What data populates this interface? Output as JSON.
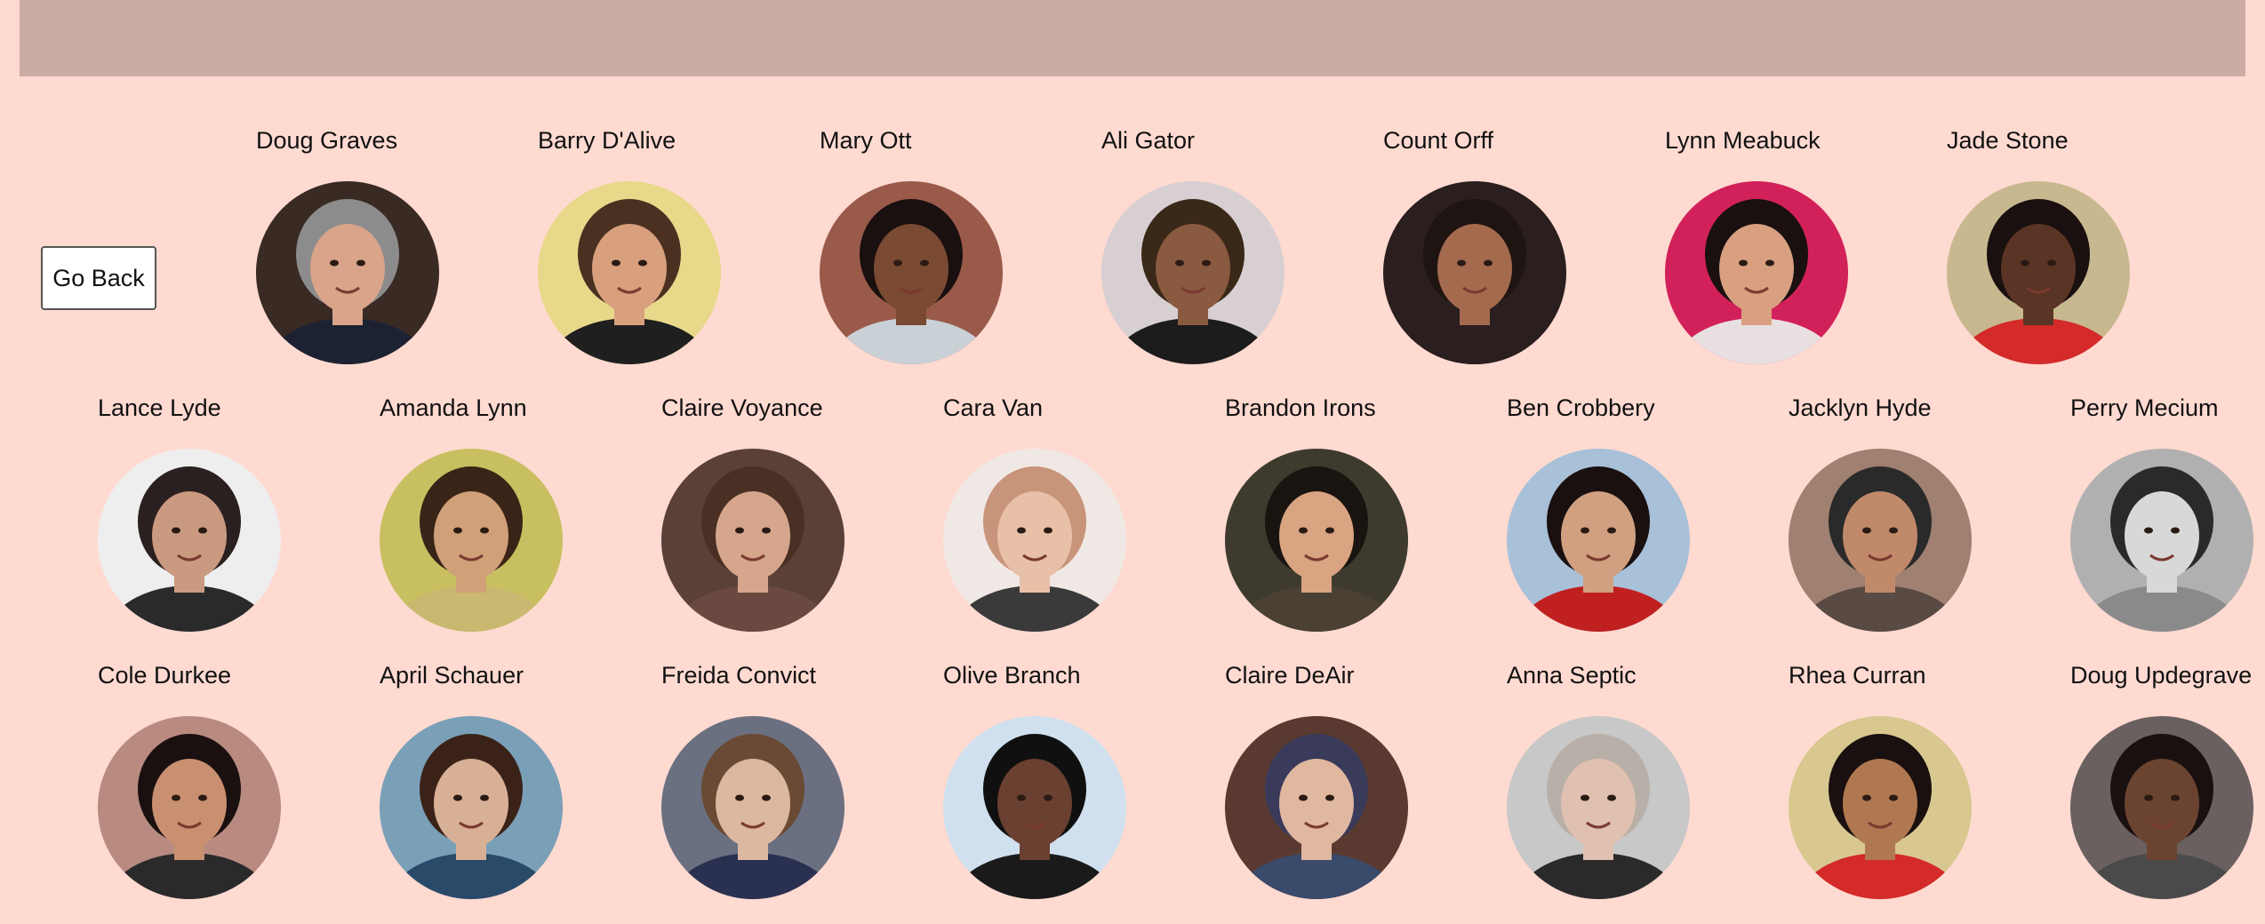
{
  "header": {
    "background_color": "#CBACA5"
  },
  "actions": {
    "go_back_label": "Go Back"
  },
  "page": {
    "background_color": "#FFDAD1"
  },
  "people": [
    {
      "name": "Doug Graves",
      "bg": "#3a2a24",
      "skin": "#d9a48a",
      "hair": "#8c8c8c",
      "shirt": "#1d2233"
    },
    {
      "name": "Barry D'Alive",
      "bg": "#e8d88a",
      "skin": "#d9a07e",
      "hair": "#4a3020",
      "shirt": "#1f1f1f"
    },
    {
      "name": "Mary Ott",
      "bg": "#9a5a4a",
      "skin": "#7a4a32",
      "hair": "#1a1010",
      "shirt": "#c9d0d6"
    },
    {
      "name": "Ali Gator",
      "bg": "#d8cfd2",
      "skin": "#8a5a40",
      "hair": "#3a2818",
      "shirt": "#1c1c1c"
    },
    {
      "name": "Count Orff",
      "bg": "#2a1e1e",
      "skin": "#a46a4e",
      "hair": "#1e1412",
      "shirt": "#2a1e1e"
    },
    {
      "name": "Lynn Meabuck",
      "bg": "#d2215a",
      "skin": "#d8a080",
      "hair": "#1a1010",
      "shirt": "#e8e0e0"
    },
    {
      "name": "Jade Stone",
      "bg": "#c8b890",
      "skin": "#5a3424",
      "hair": "#1a1010",
      "shirt": "#d42a2a"
    },
    {
      "name": "Lance Lyde",
      "bg": "#eeeeee",
      "skin": "#c99a80",
      "hair": "#2a2020",
      "shirt": "#2a2a2a"
    },
    {
      "name": "Amanda Lynn",
      "bg": "#c8c060",
      "skin": "#d0a078",
      "hair": "#3a2418",
      "shirt": "#c8b870"
    },
    {
      "name": "Claire Voyance",
      "bg": "#5a4038",
      "skin": "#d6a68c",
      "hair": "#4a3024",
      "shirt": "#6a4a40"
    },
    {
      "name": "Cara Van",
      "bg": "#f0e8e4",
      "skin": "#e8c0a8",
      "hair": "#c8947a",
      "shirt": "#3a3a3a"
    },
    {
      "name": "Brandon Irons",
      "bg": "#3e3a2e",
      "skin": "#d8a482",
      "hair": "#1a1410",
      "shirt": "#4a4034"
    },
    {
      "name": "Ben Crobbery",
      "bg": "#a8c0d8",
      "skin": "#d0a080",
      "hair": "#1a1010",
      "shirt": "#c02020"
    },
    {
      "name": "Jacklyn Hyde",
      "bg": "#a08070",
      "skin": "#c08a6a",
      "hair": "#2a2a2a",
      "shirt": "#5a4a44"
    },
    {
      "name": "Perry Mecium",
      "bg": "#b0b0b0",
      "skin": "#d8d8d8",
      "hair": "#2a2a2a",
      "shirt": "#8a8a8a"
    },
    {
      "name": "Cole Durkee",
      "bg": "#b88a80",
      "skin": "#c89070",
      "hair": "#1a1010",
      "shirt": "#2a2a2a"
    },
    {
      "name": "April Schauer",
      "bg": "#7aa0b8",
      "skin": "#d8b096",
      "hair": "#3a2218",
      "shirt": "#2a4a6a"
    },
    {
      "name": "Freida Convict",
      "bg": "#6a7080",
      "skin": "#dcb8a0",
      "hair": "#6a4a34",
      "shirt": "#2a3050"
    },
    {
      "name": "Olive Branch",
      "bg": "#d0e0ee",
      "skin": "#6a4030",
      "hair": "#101010",
      "shirt": "#1a1a1a"
    },
    {
      "name": "Claire DeAir",
      "bg": "#5a3a30",
      "skin": "#e0b8a0",
      "hair": "#3a3a5a",
      "shirt": "#3a4a6a"
    },
    {
      "name": "Anna Septic",
      "bg": "#c8c8c8",
      "skin": "#e0c0b0",
      "hair": "#b8b0a8",
      "shirt": "#2a2a2a"
    },
    {
      "name": "Rhea Curran",
      "bg": "#d8c890",
      "skin": "#b07850",
      "hair": "#1a1010",
      "shirt": "#d42a2a"
    },
    {
      "name": "Doug Updegrave",
      "bg": "#6a6060",
      "skin": "#6a4430",
      "hair": "#1a1010",
      "shirt": "#4a4a4a"
    }
  ]
}
